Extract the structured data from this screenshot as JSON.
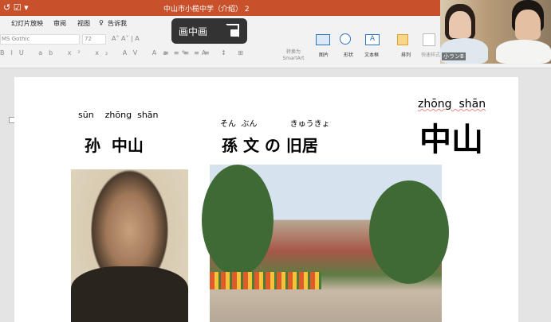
{
  "titlebar": {
    "document_title": "中山市小榄中学（介绍） 2"
  },
  "menu": [
    "幻灯片放映",
    "审阅",
    "视图",
    "告诉我"
  ],
  "toolbar": {
    "font_name": "MS Gothic",
    "font_size": "72",
    "convert_label": "转换为 SmartArt",
    "picture": "图片",
    "shape": "形状",
    "textbox": "文本框",
    "arrange": "排列",
    "quick_styles": "快速样式"
  },
  "pip": {
    "label": "画中画"
  },
  "video": {
    "participant": "小ランB"
  },
  "slide": {
    "pinyin1": "sūn    zhōng  shān",
    "title1": "孙  中山",
    "kana": "そん  ぶん             きゅうきょ",
    "title2": "孫 文 の 旧居",
    "pinyin3": "zhōng  shān",
    "title3": "中山"
  }
}
